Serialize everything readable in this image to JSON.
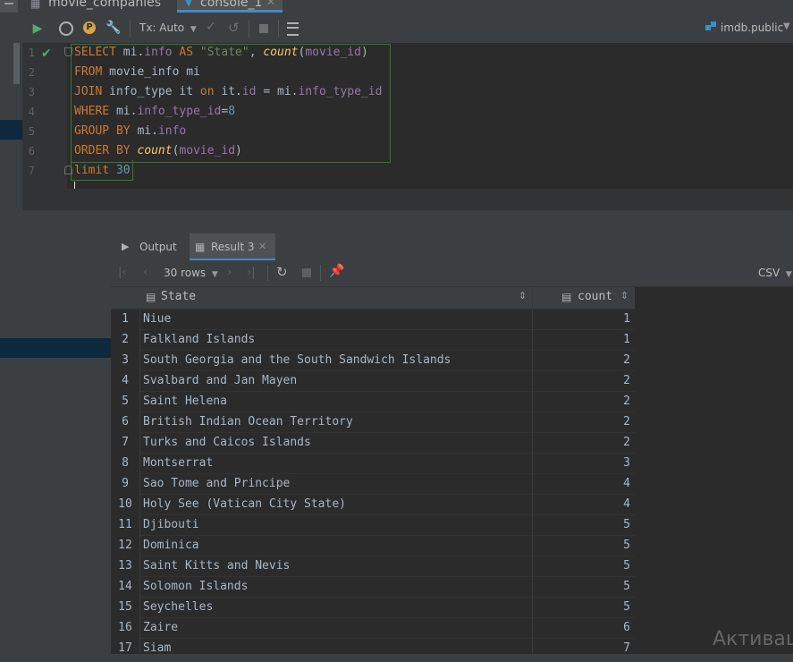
{
  "tabs": [
    {
      "label": "movie_companies"
    },
    {
      "label": "console_1"
    }
  ],
  "toolbar": {
    "tx_mode": "Tx: Auto",
    "schema": "imdb.public"
  },
  "editor": {
    "line_numbers": [
      "1",
      "2",
      "3",
      "4",
      "5",
      "6",
      "7"
    ],
    "lines": [
      [
        {
          "t": "kw",
          "v": "SELECT "
        },
        {
          "t": "plain",
          "v": "mi."
        },
        {
          "t": "fld",
          "v": "info"
        },
        {
          "t": "kw",
          "v": " AS "
        },
        {
          "t": "str",
          "v": "\"State\""
        },
        {
          "t": "plain",
          "v": ", "
        },
        {
          "t": "fn",
          "v": "count"
        },
        {
          "t": "plain",
          "v": "("
        },
        {
          "t": "fld",
          "v": "movie_id"
        },
        {
          "t": "plain",
          "v": ")"
        }
      ],
      [
        {
          "t": "kw",
          "v": "FROM "
        },
        {
          "t": "plain",
          "v": "movie_info mi"
        }
      ],
      [
        {
          "t": "kw",
          "v": "JOIN "
        },
        {
          "t": "plain",
          "v": "info_type it "
        },
        {
          "t": "kw",
          "v": "on "
        },
        {
          "t": "plain",
          "v": "it."
        },
        {
          "t": "fld",
          "v": "id"
        },
        {
          "t": "plain",
          "v": " = mi."
        },
        {
          "t": "fld",
          "v": "info_type_id"
        }
      ],
      [
        {
          "t": "kw",
          "v": "WHERE "
        },
        {
          "t": "plain",
          "v": "mi."
        },
        {
          "t": "fld",
          "v": "info_type_id"
        },
        {
          "t": "plain",
          "v": "="
        },
        {
          "t": "num",
          "v": "8"
        }
      ],
      [
        {
          "t": "kw",
          "v": "GROUP BY "
        },
        {
          "t": "plain",
          "v": "mi."
        },
        {
          "t": "fld",
          "v": "info"
        }
      ],
      [
        {
          "t": "kw",
          "v": "ORDER BY "
        },
        {
          "t": "fn",
          "v": "count"
        },
        {
          "t": "plain",
          "v": "("
        },
        {
          "t": "fld",
          "v": "movie_id"
        },
        {
          "t": "plain",
          "v": ")"
        }
      ],
      [
        {
          "t": "kw",
          "v": "limit "
        },
        {
          "t": "num",
          "v": "30"
        }
      ]
    ]
  },
  "results": {
    "tabs": [
      {
        "label": "Output"
      },
      {
        "label": "Result 3"
      }
    ],
    "rows_label": "30 rows",
    "export_label": "CSV",
    "columns": [
      "State",
      "count"
    ],
    "rows": [
      {
        "n": "1",
        "state": "Niue",
        "count": "1"
      },
      {
        "n": "2",
        "state": "Falkland Islands",
        "count": "1"
      },
      {
        "n": "3",
        "state": "South Georgia and the South Sandwich Islands",
        "count": "2"
      },
      {
        "n": "4",
        "state": "Svalbard and Jan Mayen",
        "count": "2"
      },
      {
        "n": "5",
        "state": "Saint Helena",
        "count": "2"
      },
      {
        "n": "6",
        "state": "British Indian Ocean Territory",
        "count": "2"
      },
      {
        "n": "7",
        "state": "Turks and Caicos Islands",
        "count": "2"
      },
      {
        "n": "8",
        "state": "Montserrat",
        "count": "3"
      },
      {
        "n": "9",
        "state": "Sao Tome and Principe",
        "count": "4"
      },
      {
        "n": "10",
        "state": "Holy See (Vatican City State)",
        "count": "4"
      },
      {
        "n": "11",
        "state": "Djibouti",
        "count": "5"
      },
      {
        "n": "12",
        "state": "Dominica",
        "count": "5"
      },
      {
        "n": "13",
        "state": "Saint Kitts and Nevis",
        "count": "5"
      },
      {
        "n": "14",
        "state": "Solomon Islands",
        "count": "5"
      },
      {
        "n": "15",
        "state": "Seychelles",
        "count": "5"
      },
      {
        "n": "16",
        "state": "Zaire",
        "count": "6"
      },
      {
        "n": "17",
        "state": "Siam",
        "count": "7"
      }
    ]
  },
  "watermark": "Активац",
  "icons": [
    "table-icon",
    "console-icon",
    "run-icon",
    "history-icon",
    "settings-icon",
    "wrench-icon",
    "commit-icon",
    "rollback-icon",
    "stop-icon",
    "grid-icon",
    "schema-icon",
    "first-page-icon",
    "prev-page-icon",
    "next-page-icon",
    "last-page-icon",
    "refresh-icon",
    "pin-icon",
    "sort-icon",
    "column-icon",
    "check-icon"
  ],
  "colors": {
    "keyword": "#cc7832",
    "function": "#ffc66d",
    "field": "#9876aa",
    "string": "#6a8759",
    "number": "#6897bb",
    "selection_border": "#2e7d32",
    "accent": "#4a88c7"
  }
}
